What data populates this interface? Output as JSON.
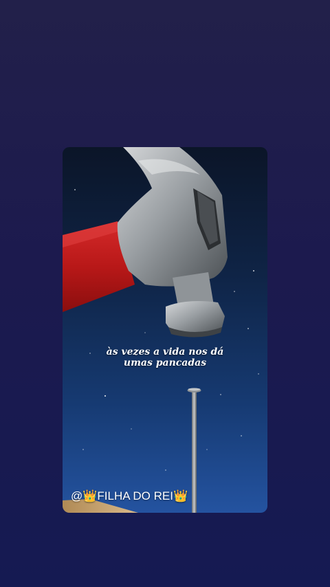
{
  "post": {
    "caption_line1": "às vezes a vida nos dá",
    "caption_line2": "umas pancadas",
    "watermark": "@👑FILHA DO REI👑"
  },
  "colors": {
    "background_top": "#22204a",
    "background_bottom": "#151a52",
    "handle_red": "#c81e1e",
    "steel": "#9a9fa3"
  },
  "icons": {
    "hammer": "hammer-illustration",
    "nail": "nail-illustration"
  }
}
